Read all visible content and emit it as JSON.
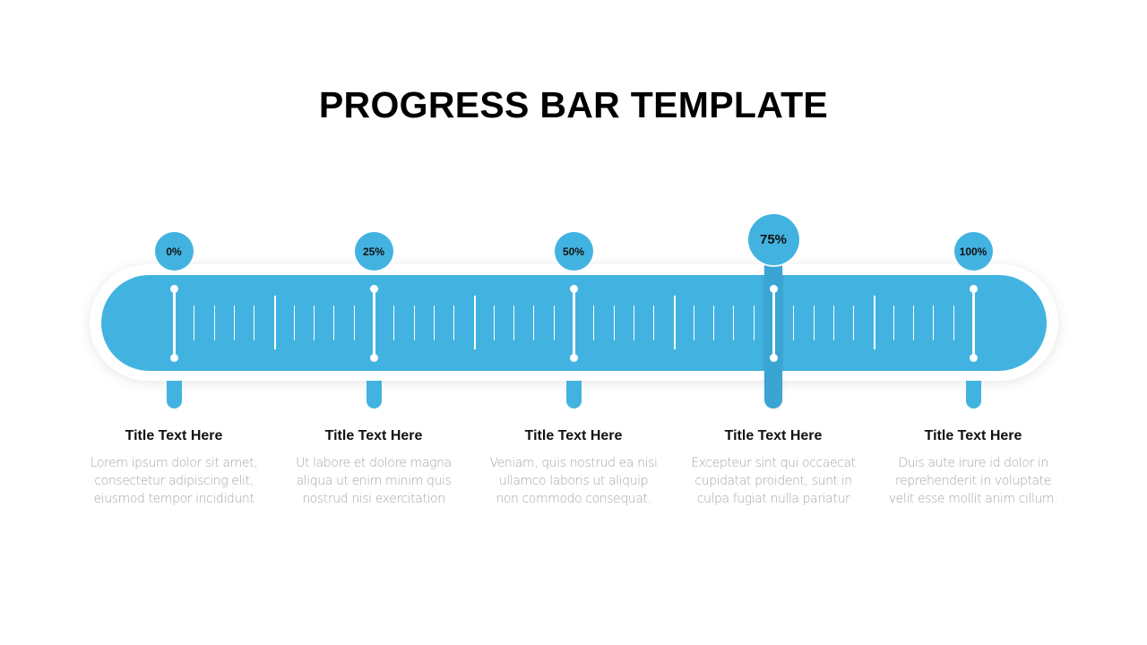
{
  "title": "PROGRESS BAR TEMPLATE",
  "colors": {
    "accent": "#42b3e0",
    "accent_dark": "#3aa5d2",
    "text": "#111111",
    "muted": "#a6a6a6"
  },
  "progress": {
    "value_percent": 75,
    "highlighted_milestone": 3
  },
  "milestones": [
    {
      "label": "0%",
      "title": "Title Text Here",
      "desc": [
        "Lorem ipsum dolor sit amet,",
        "consectetur adipiscing elit,",
        "eiusmod tempor incididunt"
      ]
    },
    {
      "label": "25%",
      "title": "Title Text Here",
      "desc": [
        "Ut labore et dolore magna",
        "aliqua ut enim minim quis",
        "nostrud nisi exercitation"
      ]
    },
    {
      "label": "50%",
      "title": "Title Text Here",
      "desc": [
        "Veniam, quis nostrud ea nisi",
        "ullamco laboris ut aliquip",
        "non commodo consequat."
      ]
    },
    {
      "label": "75%",
      "title": "Title Text Here",
      "desc": [
        "Excepteur sint qui occaecat",
        "cupidatat proident, sunt in",
        "culpa fugiat nulla pariatur"
      ]
    },
    {
      "label": "100%",
      "title": "Title Text Here",
      "desc": [
        "Duis aute irure id dolor in",
        "reprehenderit in voluptate",
        "velit esse mollit anim cillum."
      ]
    }
  ]
}
